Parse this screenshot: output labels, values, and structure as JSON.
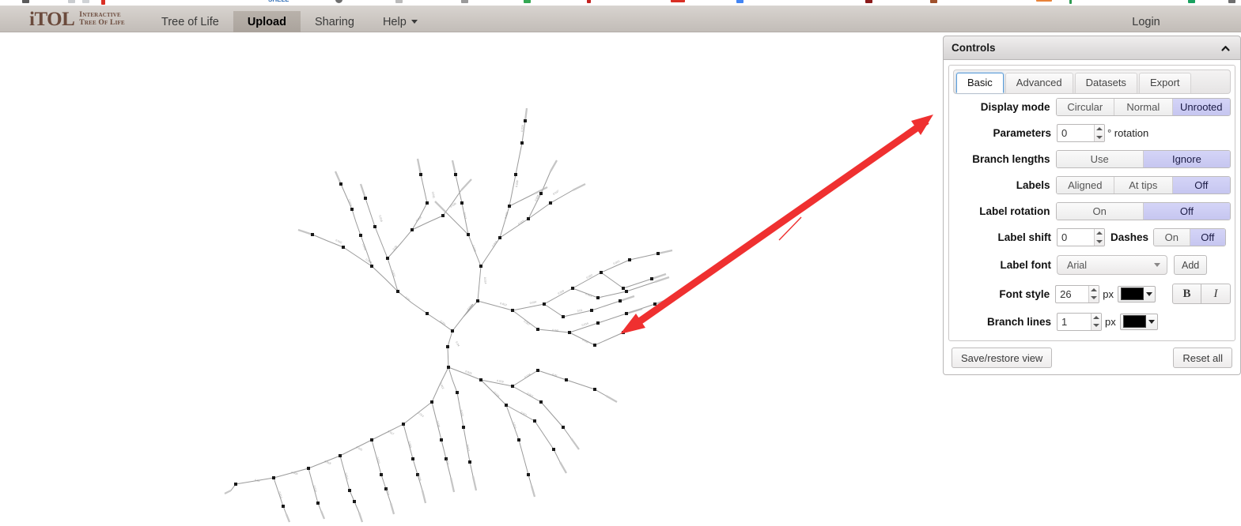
{
  "browser": {
    "favicon_colors": [
      "#5a5a5a",
      "#9aa0a6",
      "#d93025",
      "#8c8c8c",
      "#2b6bb5",
      "#777777",
      "#34a853",
      "#c5221f",
      "#d93025",
      "#4285f4",
      "#9aa0a6",
      "#8b1a1a",
      "#a0522d",
      "#e8833a",
      "#2e9b51",
      "#9aa0a6",
      "#4285f4",
      "#1aa260",
      "#5f6368"
    ],
    "favicon_text": "SHELL"
  },
  "nav": {
    "logo": {
      "main": "iTOL",
      "sub_line1": "Interactive",
      "sub_line2": "Tree Of Life"
    },
    "items": [
      {
        "label": "Tree of Life",
        "active": false,
        "caret": false
      },
      {
        "label": "Upload",
        "active": true,
        "caret": false
      },
      {
        "label": "Sharing",
        "active": false,
        "caret": false
      },
      {
        "label": "Help",
        "active": false,
        "caret": true
      }
    ],
    "login_label": "Login"
  },
  "controls": {
    "title": "Controls",
    "collapse_icon": "chevron-up-icon",
    "tabs": [
      {
        "label": "Basic",
        "active": true
      },
      {
        "label": "Advanced",
        "active": false
      },
      {
        "label": "Datasets",
        "active": false
      },
      {
        "label": "Export",
        "active": false
      }
    ],
    "display_mode": {
      "label": "Display mode",
      "options": [
        "Circular",
        "Normal",
        "Unrooted"
      ],
      "selected": "Unrooted"
    },
    "parameters": {
      "label": "Parameters",
      "value": "0",
      "unit": "° rotation"
    },
    "branch_lengths": {
      "label": "Branch lengths",
      "options": [
        "Use",
        "Ignore"
      ],
      "selected": "Ignore"
    },
    "labels": {
      "label": "Labels",
      "options": [
        "Aligned",
        "At tips",
        "Off"
      ],
      "selected": "Off"
    },
    "label_rotation": {
      "label": "Label rotation",
      "options": [
        "On",
        "Off"
      ],
      "selected": "Off"
    },
    "label_shift": {
      "label": "Label shift",
      "value": "0"
    },
    "dashes": {
      "label": "Dashes",
      "options": [
        "On",
        "Off"
      ],
      "selected": "Off"
    },
    "label_font": {
      "label": "Label font",
      "selected": "Arial",
      "add_label": "Add"
    },
    "font_style": {
      "label": "Font style",
      "size": "26",
      "unit": "px",
      "color": "#000000",
      "bold_label": "B",
      "italic_label": "I"
    },
    "branch_lines": {
      "label": "Branch lines",
      "width": "1",
      "unit": "px",
      "color": "#000000"
    },
    "footer": {
      "save_restore": "Save/restore view",
      "reset_all": "Reset all"
    }
  },
  "tree": {
    "type": "unrooted-phylogram",
    "branch_color": "#9b9b9b",
    "node_color": "#1a1a1a",
    "label_color": "#8a8a8a"
  },
  "annotation": {
    "arrow_color": "#ef3030",
    "kind": "double-headed-arrow"
  }
}
